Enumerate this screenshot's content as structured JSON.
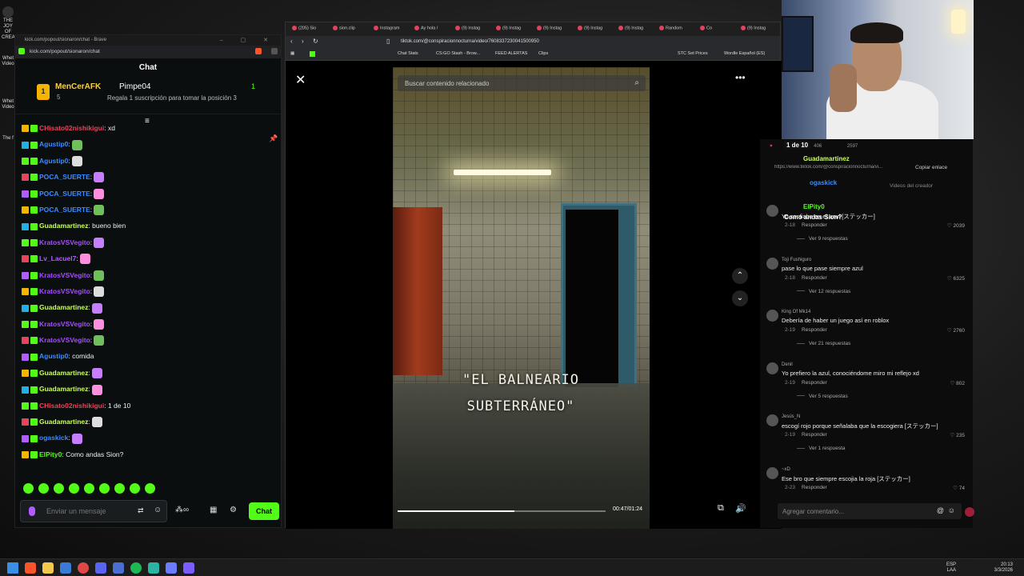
{
  "desktop": {
    "icons": [
      "THE JOY OF CREATIO...",
      "Whet Video",
      "Whet Video",
      "The f"
    ]
  },
  "kick": {
    "window_title": "kick.com/popout/sionaron/chat - Brave",
    "url": "kick.com/popout/sionaron/chat",
    "chat_title": "Chat",
    "top_gifter_1": {
      "rank": "1",
      "name": "MenCerAFK",
      "count": "5"
    },
    "top_gifter_2": {
      "name": "Pimpe04",
      "rank": "1"
    },
    "promo": "Regala 1 suscripción para tomar la posición 3",
    "messages": [
      {
        "user": "CHisato02nishikigui",
        "text": ": xd",
        "color": "#e8435b"
      },
      {
        "user": "Agustip0",
        "text": ":",
        "color": "#3b8bff"
      },
      {
        "user": "Agustip0",
        "text": ":",
        "color": "#3b8bff"
      },
      {
        "user": "POCA_SUERTE",
        "text": ":",
        "color": "#3b8bff"
      },
      {
        "user": "POCA_SUERTE",
        "text": ":",
        "color": "#3b8bff"
      },
      {
        "user": "POCA_SUERTE",
        "text": ":",
        "color": "#3b8bff"
      },
      {
        "user": "Guadamartinez",
        "text": ": bueno bien",
        "color": "#c9ff5c"
      },
      {
        "user": "KratosVSVegito",
        "text": ":",
        "color": "#a64dff"
      },
      {
        "user": "Lv_Lacuel7",
        "text": ":",
        "color": "#b45cff"
      },
      {
        "user": "KratosVSVegito",
        "text": ":",
        "color": "#a64dff"
      },
      {
        "user": "KratosVSVegito",
        "text": ":",
        "color": "#a64dff"
      },
      {
        "user": "Guadamartinez",
        "text": ":",
        "color": "#c9ff5c"
      },
      {
        "user": "KratosVSVegito",
        "text": ":",
        "color": "#a64dff"
      },
      {
        "user": "KratosVSVegito",
        "text": ":",
        "color": "#a64dff"
      },
      {
        "user": "Agustip0",
        "text": ": comida",
        "color": "#3b8bff"
      },
      {
        "user": "Guadamartinez",
        "text": ":",
        "color": "#c9ff5c"
      },
      {
        "user": "Guadamartinez",
        "text": ":",
        "color": "#c9ff5c"
      },
      {
        "user": "CHisato02nishikigui",
        "text": ": 1 de 10",
        "color": "#e8435b"
      },
      {
        "user": "Guadamartinez",
        "text": ":",
        "color": "#c9ff5c"
      },
      {
        "user": "ogaskick",
        "text": ":",
        "color": "#3b8bff"
      },
      {
        "user": "ElPity0",
        "text": ": Como andas Sion?",
        "color": "#53fc18"
      }
    ],
    "input_placeholder": "Enviar un mensaje",
    "send_label": "Chat"
  },
  "browser": {
    "tabs": [
      "(205) Sio",
      "sion.clip",
      "Instagram",
      "Ay hola /",
      "(9) Instag",
      "(9) Instag",
      "(9) Instag",
      "(9) Instag",
      "(9) Instag",
      "Random",
      "Co",
      "(9) Instag"
    ],
    "url": "tiktok.com/@conspiracionnocturna/video/7608337230041500950",
    "bookmarks": [
      "Chat Stats",
      "CS:GO Stash - Brow...",
      "FEED ALERTAS",
      "Clips",
      "STC Set Prices",
      "Wordle Español (ES)"
    ]
  },
  "tiktok": {
    "search_placeholder": "Buscar contenido relacionado",
    "caption_line1": "\"EL BALNEARIO",
    "caption_line2": "SUBTERRÁNEO\"",
    "time": "00:47/01:24",
    "progress": 0.56,
    "stats": [
      "406",
      "2597"
    ],
    "link_text": "https://www.tiktok.com/@conspiracionnocturna/vi...",
    "copy_link": "Copiar enlace",
    "creator_videos": "Videos del creador",
    "overlay_msgs": [
      {
        "user": "1 de 10",
        "color": "#ffffff"
      },
      {
        "user": "Guadamartinez",
        "color": "#c9ff5c"
      },
      {
        "user": "ogaskick",
        "color": "#3b8bff"
      },
      {
        "user": "ElPity0",
        "color": "#53fc18"
      },
      {
        "user": "Como andas Sion?",
        "color": "#ffffff"
      }
    ],
    "comments": [
      {
        "name": "",
        "text": "Yo confiaba en el azul [ステッカー]",
        "date": "2-18",
        "reply": "Responder",
        "likes": "2039",
        "more": "Ver 9 respuestas"
      },
      {
        "name": "Toji Fushiguro",
        "text": "pase lo que pase siempre azul",
        "date": "2-18",
        "reply": "Responder",
        "likes": "6325",
        "more": "Ver 12 respuestas"
      },
      {
        "name": "King Of Mk14",
        "text": "Debería de haber un juego así en roblox",
        "date": "2-19",
        "reply": "Responder",
        "likes": "2760",
        "more": "Ver 21 respuestas"
      },
      {
        "name": "Denil",
        "text": "Yo prefiero la azul, conociéndome miro mi reflejo xd",
        "date": "2-19",
        "reply": "Responder",
        "likes": "802",
        "more": "Ver 5 respuestas"
      },
      {
        "name": "Jesús_N",
        "text": "escogí rojo porque señalaba que la escogiera [ステッカー]",
        "date": "2-19",
        "reply": "Responder",
        "likes": "235",
        "more": "Ver 1 respuesta"
      },
      {
        "name": "~xD",
        "text": "Ese bro que siempre escojia la roja [ステッカー]",
        "date": "2-23",
        "reply": "Responder",
        "likes": "74",
        "more": ""
      }
    ],
    "add_comment": "Agregar comentario..."
  },
  "taskbar": {
    "lang": "ESP",
    "lang2": "LAA",
    "time": "20:13",
    "date": "3/3/2026"
  },
  "colors": {
    "kick_green": "#53fc18",
    "tiktok_red": "#fe2c55"
  }
}
